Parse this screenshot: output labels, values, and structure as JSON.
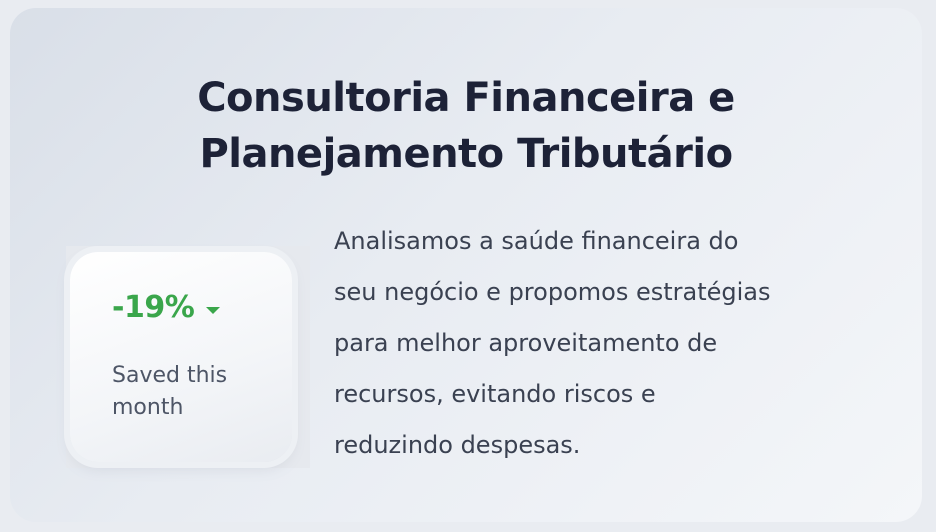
{
  "section": {
    "title_lines": [
      "Consultoria Financeira e",
      "Planejamento Tributário"
    ],
    "description_lines": [
      "Analisamos a saúde financeira do",
      "seu negócio e propomos estratégias",
      "para melhor aproveitamento de",
      "recursos, evitando riscos e",
      "reduzindo despesas."
    ]
  },
  "stat": {
    "value": "-19%",
    "trend_icon": "caret-down-icon",
    "caption": "Saved this month"
  },
  "colors": {
    "title": "#1d2237",
    "body_text": "#3a4151",
    "positive_green": "#3aa64b",
    "caption_text": "#4d5566"
  }
}
